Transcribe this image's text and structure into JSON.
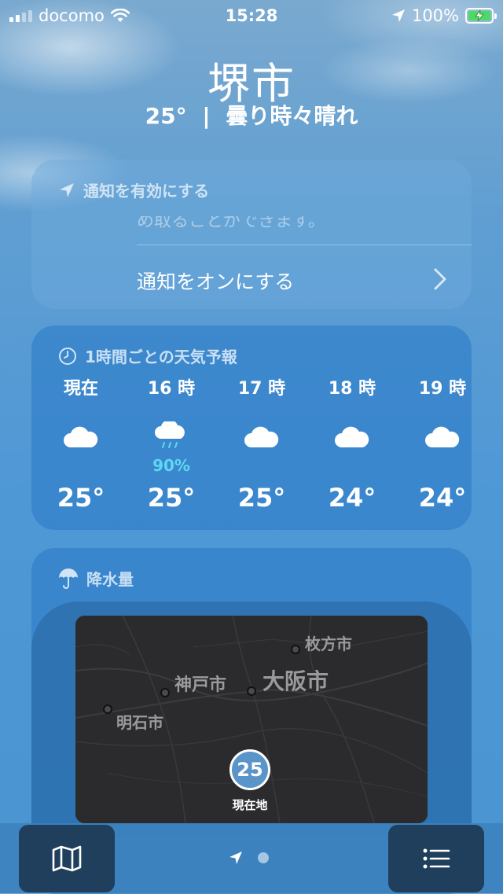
{
  "status_bar": {
    "carrier": "docomo",
    "time": "15:28",
    "battery": "100%",
    "icons": [
      "signal-icon",
      "wifi-icon",
      "location-icon",
      "battery-charging-icon"
    ]
  },
  "header": {
    "city": "堺市",
    "temperature": "25°",
    "separator": "|",
    "condition": "曇り時々晴れ"
  },
  "notification_card": {
    "title": "通知を有効にする",
    "faded_text": "め取ることができます。",
    "action": "通知をオンにする",
    "icon": "location-arrow-icon"
  },
  "hourly_card": {
    "title": "1時間ごとの天気予報",
    "icon": "clock-icon",
    "hours": [
      {
        "label": "現在",
        "icon": "cloud-icon",
        "precip": "",
        "temp": "25°"
      },
      {
        "label": "16 時",
        "icon": "cloud-rain-icon",
        "precip": "90%",
        "temp": "25°"
      },
      {
        "label": "17 時",
        "icon": "cloud-icon",
        "precip": "",
        "temp": "25°"
      },
      {
        "label": "18 時",
        "icon": "cloud-icon",
        "precip": "",
        "temp": "24°"
      },
      {
        "label": "19 時",
        "icon": "cloud-icon",
        "precip": "",
        "temp": "24°"
      }
    ]
  },
  "precip_card": {
    "title": "降水量",
    "icon": "umbrella-icon",
    "map": {
      "cities": [
        "枚方市",
        "神戸市",
        "大阪市",
        "明石市"
      ],
      "current_temp": "25",
      "current_label": "現在地"
    }
  },
  "toolbar": {
    "left_icon": "map-icon",
    "right_icon": "list-icon",
    "page_indicator_icon": "location-arrow-icon"
  },
  "colors": {
    "precip_accent": "#5fd7f0",
    "battery_green": "#4cd964",
    "map_background": "#2b2b2d"
  }
}
